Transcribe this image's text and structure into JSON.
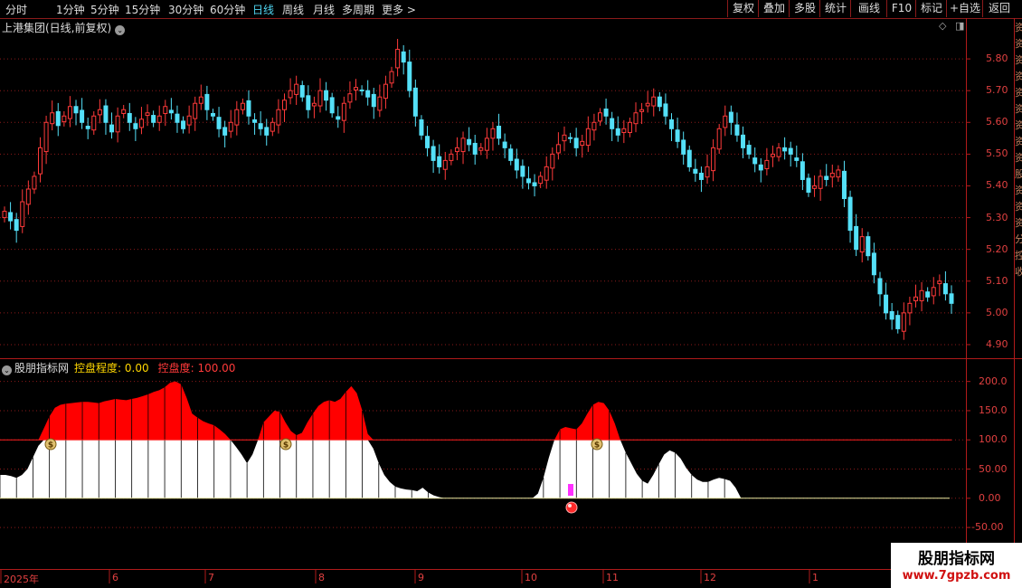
{
  "toolbar": {
    "periods": [
      "分时",
      "1分钟",
      "5分钟",
      "15分钟",
      "30分钟",
      "60分钟",
      "日线",
      "周线",
      "月线",
      "多周期",
      "更多 >"
    ],
    "active_period": "日线",
    "right_buttons": [
      "复权",
      "叠加",
      "多股",
      "统计",
      "画线",
      "F10",
      "标记",
      "+自选",
      "返回"
    ]
  },
  "main_chart": {
    "title": "上港集团(日线,前复权)",
    "y_ticks": [
      "5.80",
      "5.70",
      "5.60",
      "5.50",
      "5.40",
      "5.30",
      "5.20",
      "5.10",
      "5.00",
      "4.90"
    ]
  },
  "indicator": {
    "name": "股朋指标网",
    "label1": "控盘程度: 0.00",
    "label2": "控盘度: 100.00",
    "y_ticks": [
      "200.0",
      "150.0",
      "100.0",
      "50.00",
      "0.00",
      "-50.00"
    ]
  },
  "x_axis": {
    "labels": [
      "2025年",
      "6",
      "7",
      "8",
      "9",
      "10",
      "11",
      "12",
      "1"
    ]
  },
  "side_text": "资资资资资资资资资股资资资分控收",
  "watermark": {
    "line1": "股朋指标网",
    "line2": "www.7gpzb.com"
  },
  "colors": {
    "up": "#ff3a3a",
    "down": "#54e0f8",
    "grid": "#8b1a1a",
    "fill_red": "#ff0000",
    "fill_white": "#ffffff"
  },
  "chart_data": [
    {
      "type": "candlestick",
      "title": "上港集团(日线,前复权)",
      "ylim": [
        4.86,
        5.9
      ],
      "closes": [
        5.32,
        5.29,
        5.26,
        5.35,
        5.39,
        5.43,
        5.52,
        5.6,
        5.63,
        5.59,
        5.62,
        5.65,
        5.63,
        5.6,
        5.58,
        5.62,
        5.64,
        5.6,
        5.57,
        5.62,
        5.64,
        5.6,
        5.58,
        5.61,
        5.63,
        5.6,
        5.62,
        5.65,
        5.63,
        5.6,
        5.58,
        5.62,
        5.66,
        5.68,
        5.64,
        5.62,
        5.58,
        5.56,
        5.6,
        5.64,
        5.66,
        5.62,
        5.6,
        5.58,
        5.56,
        5.6,
        5.64,
        5.67,
        5.7,
        5.72,
        5.68,
        5.64,
        5.66,
        5.7,
        5.67,
        5.63,
        5.61,
        5.66,
        5.69,
        5.71,
        5.7,
        5.68,
        5.65,
        5.68,
        5.72,
        5.76,
        5.83,
        5.79,
        5.7,
        5.62,
        5.56,
        5.52,
        5.48,
        5.46,
        5.48,
        5.5,
        5.52,
        5.55,
        5.53,
        5.5,
        5.52,
        5.55,
        5.58,
        5.55,
        5.52,
        5.48,
        5.45,
        5.43,
        5.41,
        5.4,
        5.43,
        5.46,
        5.5,
        5.53,
        5.56,
        5.55,
        5.52,
        5.54,
        5.58,
        5.6,
        5.63,
        5.62,
        5.58,
        5.56,
        5.58,
        5.6,
        5.63,
        5.64,
        5.66,
        5.68,
        5.65,
        5.62,
        5.58,
        5.54,
        5.5,
        5.46,
        5.44,
        5.42,
        5.46,
        5.52,
        5.58,
        5.62,
        5.6,
        5.56,
        5.52,
        5.5,
        5.47,
        5.45,
        5.48,
        5.5,
        5.52,
        5.51,
        5.5,
        5.48,
        5.42,
        5.38,
        5.4,
        5.43,
        5.42,
        5.44,
        5.45,
        5.36,
        5.26,
        5.2,
        5.24,
        5.18,
        5.12,
        5.06,
        5.0,
        4.98,
        4.95,
        5.0,
        5.03,
        5.05,
        5.07,
        5.05,
        5.08,
        5.1,
        5.06,
        5.03
      ],
      "up_color": "#ff3a3a",
      "down_color": "#54e0f8"
    },
    {
      "type": "area",
      "title": "股朋指标网",
      "ylim": [
        -70,
        215
      ],
      "threshold": 100,
      "series": [
        {
          "name": "控盘度",
          "values": [
            40,
            40,
            38,
            35,
            40,
            50,
            70,
            90,
            120,
            140,
            155,
            160,
            162,
            163,
            164,
            165,
            165,
            164,
            163,
            166,
            168,
            170,
            169,
            168,
            170,
            172,
            175,
            178,
            182,
            185,
            190,
            198,
            200,
            195,
            172,
            145,
            138,
            132,
            128,
            125,
            118,
            110,
            100,
            88,
            75,
            60,
            75,
            100,
            130,
            140,
            150,
            148,
            130,
            115,
            108,
            112,
            130,
            145,
            158,
            165,
            168,
            165,
            170,
            182,
            192,
            180,
            150,
            110,
            85,
            60,
            40,
            28,
            20,
            17,
            15,
            14,
            12,
            18,
            10,
            5,
            2,
            0,
            0,
            0,
            0,
            0,
            0,
            0,
            0,
            0,
            0,
            0,
            0,
            0,
            0,
            0,
            0,
            0,
            8,
            35,
            70,
            100,
            118,
            122,
            120,
            118,
            128,
            145,
            160,
            165,
            163,
            150,
            128,
            100,
            78,
            60,
            42,
            30,
            25,
            40,
            58,
            75,
            82,
            78,
            68,
            52,
            40,
            32,
            28,
            28,
            32,
            35,
            33,
            30,
            18,
            0,
            0,
            0,
            0,
            0,
            0,
            0,
            0,
            0,
            0,
            0,
            0,
            0,
            0,
            0,
            0,
            0,
            0,
            0,
            0,
            0,
            0,
            0,
            0,
            0,
            0,
            0,
            0,
            0,
            0,
            0,
            0,
            0,
            0,
            0,
            0,
            0,
            0,
            0
          ]
        }
      ]
    }
  ]
}
